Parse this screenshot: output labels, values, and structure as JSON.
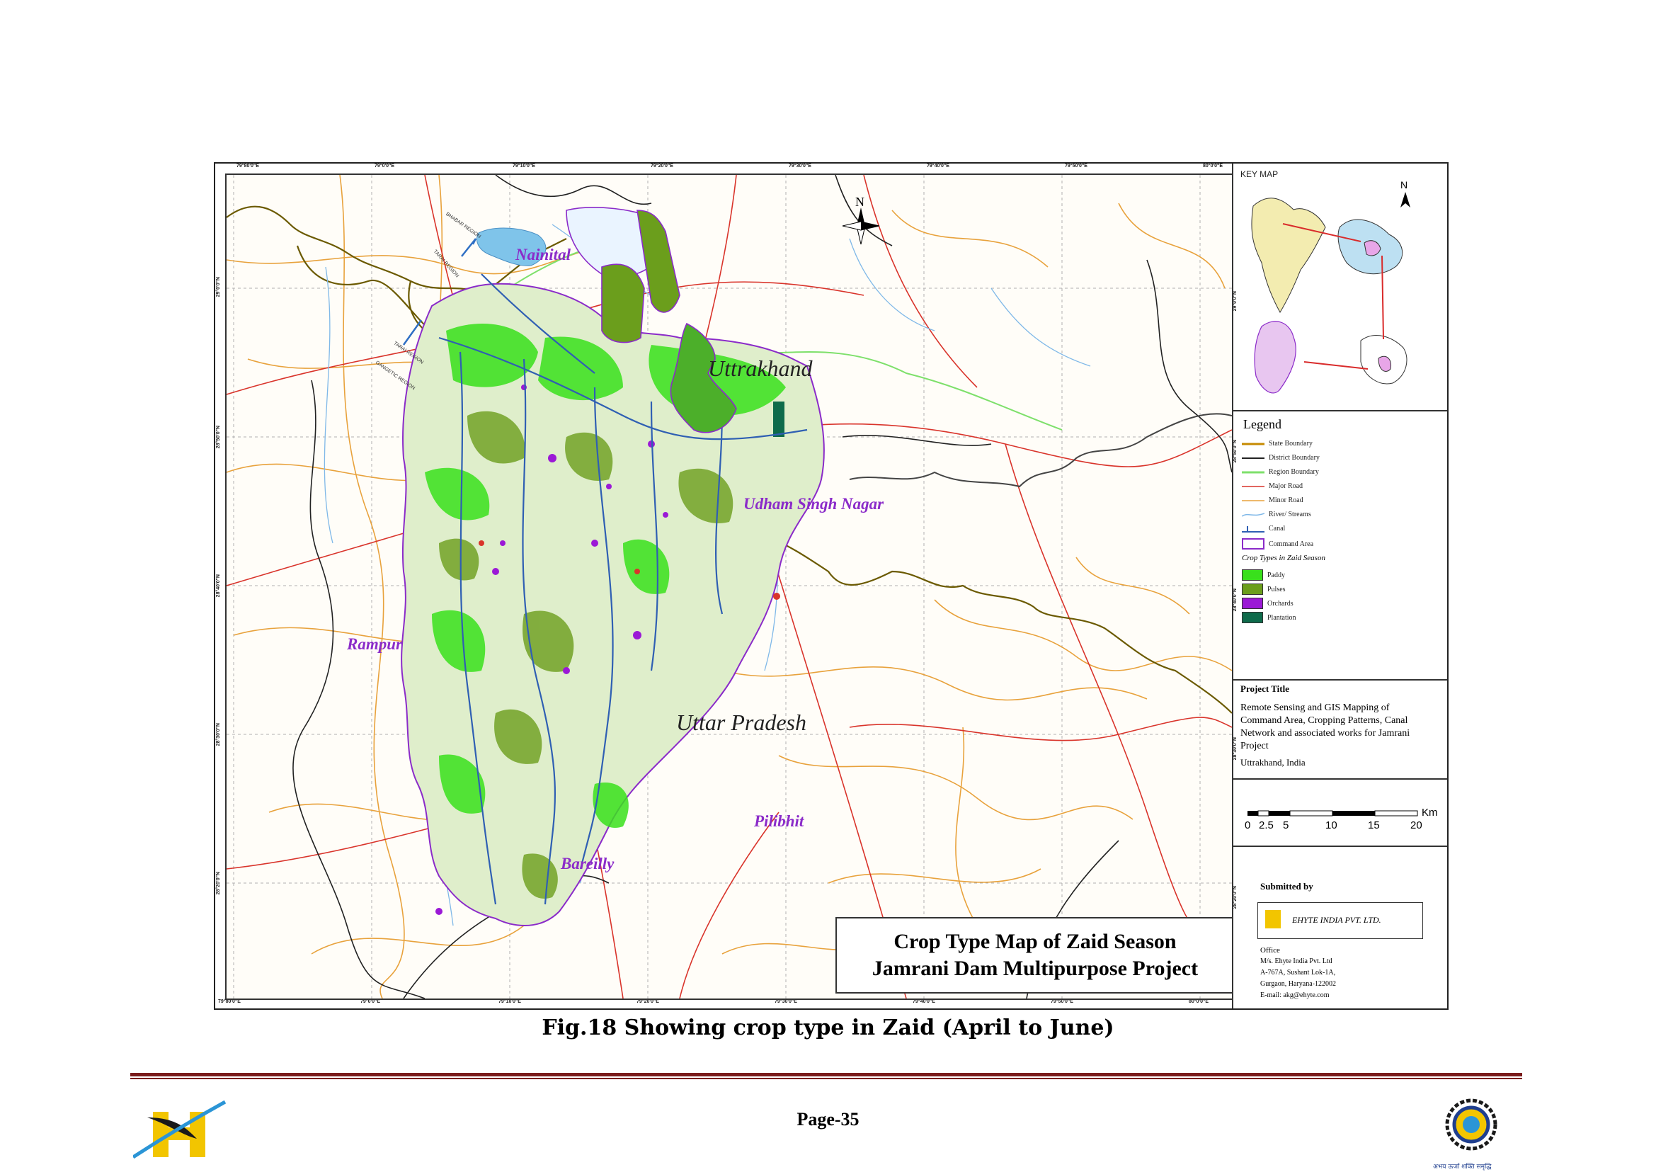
{
  "map": {
    "title_line1": "Crop Type Map of Zaid Season",
    "title_line2": "Jamrani Dam Multipurpose Project",
    "place_labels": {
      "nainital": "Nainital",
      "uttrakhand": "Uttrakhand",
      "udham_singh_nagar": "Udham Singh Nagar",
      "rampur": "Rampur",
      "uttar_pradesh": "Uttar Pradesh",
      "pilibhit": "Pilibhit",
      "bareilly": "Bareilly"
    },
    "region_labels": {
      "bhabar": "BHABAR REGION",
      "tarai_1": "TARAI REGION",
      "tarai_2": "TARAI REGION",
      "gangetic": "GANGETIC REGION"
    },
    "north_label": "N",
    "top_ticks": [
      "79°80'0\"E",
      "79°0'0\"E",
      "79°10'0\"E",
      "79°20'0\"E",
      "79°30'0\"E",
      "79°40'0\"E",
      "79°50'0\"E",
      "80°0'0\"E"
    ],
    "bottom_ticks": [
      "79°80'0\"E",
      "79°0'0\"E",
      "79°10'0\"E",
      "79°20'0\"E",
      "79°30'0\"E",
      "79°40'0\"E",
      "79°50'0\"E",
      "80°0'0\"E"
    ],
    "left_ticks": [
      "29°0'0\"N",
      "28°50'0\"N",
      "28°40'0\"N",
      "28°30'0\"N",
      "28°20'0\"N"
    ],
    "right_ticks": [
      "29°0'0\"N",
      "28°50'0\"N",
      "28°40'0\"N",
      "28°30'0\"N",
      "28°20'0\"N"
    ]
  },
  "key_map": {
    "label": "KEY MAP",
    "north_label": "N"
  },
  "legend": {
    "heading": "Legend",
    "items": [
      {
        "label": "State Boundary",
        "color": "#c58a00"
      },
      {
        "label": "District Boundary",
        "color": "#222222"
      },
      {
        "label": "Region Boundary",
        "color": "#7ee06b"
      },
      {
        "label": "Major Road",
        "color": "#d9342b"
      },
      {
        "label": "Minor Road",
        "color": "#e8a23c"
      },
      {
        "label": "River/ Streams",
        "color": "#7fb8e8"
      },
      {
        "label": "Canal",
        "color": "#2f5fb3"
      },
      {
        "label": "Command Area",
        "color": "#8b2bc9"
      }
    ],
    "crop_heading": "Crop Types in Zaid Season",
    "crops": [
      {
        "label": "Paddy",
        "color": "#39e01c"
      },
      {
        "label": "Pulses",
        "color": "#6b9e1c"
      },
      {
        "label": "Orchards",
        "color": "#9b19d6"
      },
      {
        "label": "Plantation",
        "color": "#0e6b4b"
      }
    ]
  },
  "project": {
    "heading": "Project Title",
    "description": "Remote Sensing and GIS Mapping of Command Area, Cropping Patterns, Canal Network and associated works for Jamrani Project",
    "location": "Uttrakhand, India"
  },
  "scale_bar": {
    "unit": "Km",
    "labels": [
      "0",
      "2.5",
      "5",
      "10",
      "15",
      "20"
    ]
  },
  "submitted": {
    "heading": "Submitted by",
    "company": "EHYTE INDIA PVT. LTD.",
    "office_heading": "Office",
    "address_lines": [
      "M/s. Ehyte India Pvt. Ltd",
      "A-767A, Sushant Lok-1A,",
      "Gurgaon, Haryana-122002",
      "E-mail: akg@ehyte.com"
    ]
  },
  "caption": "Fig.18   Showing crop type in Zaid (April to June)",
  "footer": {
    "page": "Page-35",
    "emblem_motto": "अभय ऊर्जा शक्ति समृद्धि"
  }
}
